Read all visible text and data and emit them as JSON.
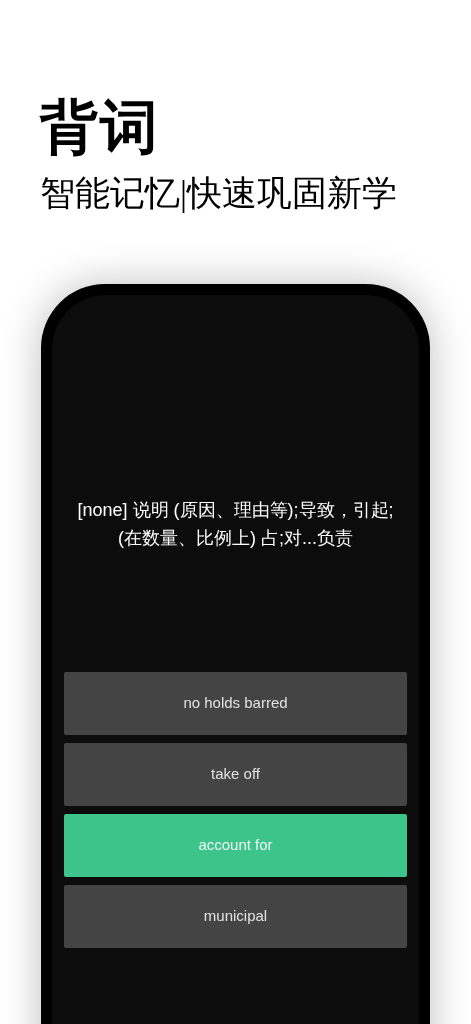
{
  "header": {
    "title": "背词",
    "subtitle": "智能记忆|快速巩固新学"
  },
  "card": {
    "definition": "[none] 说明 (原因、理由等);导致，引起;(在数量、比例上) 占;对...负责"
  },
  "options": [
    {
      "label": "no holds barred",
      "selected": false
    },
    {
      "label": "take off",
      "selected": false
    },
    {
      "label": "account for",
      "selected": true
    },
    {
      "label": "municipal",
      "selected": false
    }
  ]
}
